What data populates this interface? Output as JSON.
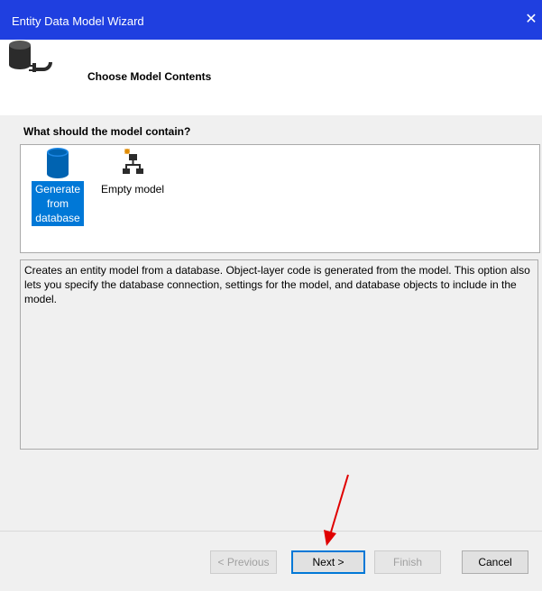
{
  "window": {
    "title": "Entity Data Model Wizard",
    "close_glyph": "✕"
  },
  "header": {
    "step_title": "Choose Model Contents",
    "icon": "database-connector-icon"
  },
  "main": {
    "question": "What should the model contain?",
    "options": [
      {
        "line1": "Generate",
        "line2": "from",
        "line3": "database",
        "icon": "database-icon",
        "selected": true
      },
      {
        "label": "Empty model",
        "icon": "model-hierarchy-icon",
        "selected": false
      }
    ],
    "description": "Creates an entity model from a database. Object-layer code is generated from the model. This option also lets you specify the database connection, settings for the model, and database objects to include in the model."
  },
  "footer": {
    "previous_label": "< Previous",
    "next_label": "Next >",
    "finish_label": "Finish",
    "cancel_label": "Cancel"
  },
  "colors": {
    "titlebar": "#1f3fe0",
    "selection": "#0078d7",
    "annotation_arrow": "#e00000"
  }
}
